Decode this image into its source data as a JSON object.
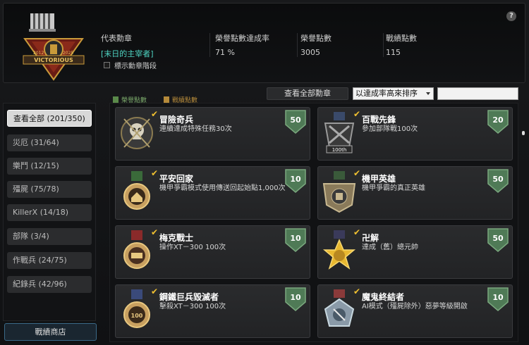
{
  "header": {
    "emblem": {
      "years_left": "2012",
      "years_right": "2025",
      "banner": "VICTORIOUS"
    },
    "help_icon": "?",
    "stats": [
      {
        "label": "代表勳章",
        "value": "[末日的主宰者]",
        "accent": "#4fd6c4"
      },
      {
        "label": "榮譽點數達成率",
        "value": "71 %"
      },
      {
        "label": "榮譽點數",
        "value": "3005"
      },
      {
        "label": "戰績點數",
        "value": "115"
      }
    ],
    "checkbox_label": "標示勳章階段"
  },
  "toolbar": {
    "legend_honor": "榮譽點數",
    "legend_battle": "戰績點數",
    "view_all": "查看全部勳章",
    "sort_selected": "以達成率高來排序",
    "search_value": ""
  },
  "sidebar": {
    "categories": [
      {
        "label": "查看全部 (201/350)",
        "active": true
      },
      {
        "label": "災厄 (31/64)"
      },
      {
        "label": "樂鬥 (12/15)"
      },
      {
        "label": "殭屍 (75/78)"
      },
      {
        "label": "KillerX (14/18)"
      },
      {
        "label": "部隊 (3/4)"
      },
      {
        "label": "作戰兵 (24/75)"
      },
      {
        "label": "紀錄兵 (42/96)"
      }
    ],
    "shop_button": "戰績商店"
  },
  "medals": [
    {
      "title": "冒險奇兵",
      "desc": "連續達成特殊任務30次",
      "points": "50"
    },
    {
      "title": "百戰先鋒",
      "desc": "參加部隊戰100次",
      "points": "20",
      "medal_text": "100th"
    },
    {
      "title": "平安回家",
      "desc": "機甲爭霸模式使用傳送回起始點1,000次",
      "points": "10"
    },
    {
      "title": "機甲英雄",
      "desc": "機甲爭霸的真正英雄",
      "points": "50"
    },
    {
      "title": "梅克戰士",
      "desc": "操作XT－300 100次",
      "points": "10"
    },
    {
      "title": "卍解",
      "desc": "達成（舊）總元帥",
      "points": "50"
    },
    {
      "title": "鋼鐵巨兵毀滅者",
      "desc": "擊殺XT－300 100次",
      "points": "10",
      "medal_text": "100"
    },
    {
      "title": "魔鬼終結者",
      "desc": "AI模式（殭屍除外）惡夢等級開啟",
      "points": "10"
    }
  ],
  "colors": {
    "honor": "#5a8a4a",
    "battle": "#b58a3a",
    "shield": "#4f7a56",
    "check": "#f0c030"
  }
}
